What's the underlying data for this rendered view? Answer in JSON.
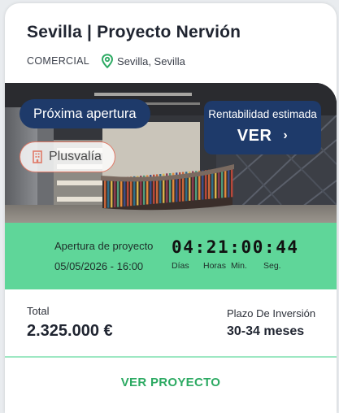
{
  "project": {
    "title": "Sevilla | Proyecto Nervión",
    "category": "COMERCIAL",
    "location": "Sevilla, Sevilla"
  },
  "badges": {
    "opening": "Próxima apertura",
    "plusvalia": "Plusvalía"
  },
  "rentabilidad": {
    "label": "Rentabilidad estimada",
    "action": "VER",
    "chevron": "›"
  },
  "countdown": {
    "label": "Apertura de proyecto",
    "date": "05/05/2026 - 16:00",
    "time": "04:21:00:44",
    "units": [
      "Días",
      "Horas",
      "Min.",
      "Seg."
    ]
  },
  "totals": {
    "total_label": "Total",
    "total_value": "2.325.000 €",
    "term_label": "Plazo De Inversión",
    "term_value": "30-34 meses"
  },
  "cta": {
    "label": "VER PROYECTO"
  },
  "icons": {
    "location": "location-pin-icon",
    "building": "building-icon",
    "chevron": "chevron-right-icon"
  },
  "colors": {
    "navy": "#1e3a6a",
    "green_band": "#5fd699",
    "green_text": "#2daa63",
    "pin_green": "#2daa63",
    "badge_border": "#e07a68"
  }
}
